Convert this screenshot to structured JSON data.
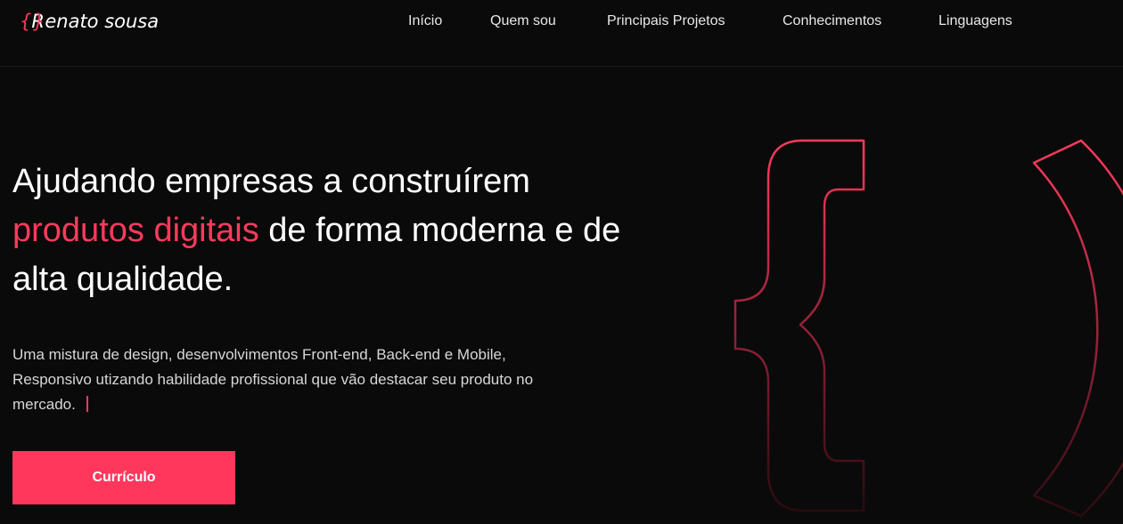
{
  "header": {
    "logo_open": "{",
    "logo_r": "R",
    "logo_close": "}",
    "logo_rest": "enato sousa",
    "nav": [
      {
        "label": "Início"
      },
      {
        "label": "Quem sou"
      },
      {
        "label": "Principais Projetos"
      },
      {
        "label": "Conhecimentos"
      },
      {
        "label": "Linguagens"
      }
    ]
  },
  "hero": {
    "title_part1": "Ajudando empresas a construírem",
    "title_accent": "produtos digitais",
    "title_part2": " de forma moderna e de alta qualidade.",
    "description": "Uma mistura de design, desenvolvimentos Front-end, Back-end e Mobile, Responsivo utizando habilidade profissional que vão destacar seu produto no mercado.",
    "button_label": "Currículo"
  },
  "colors": {
    "accent": "#ff375d",
    "background": "#0a0a0a"
  },
  "icons": [
    "curly-brace-outline-icon",
    "parenthesis-outline-icon"
  ]
}
